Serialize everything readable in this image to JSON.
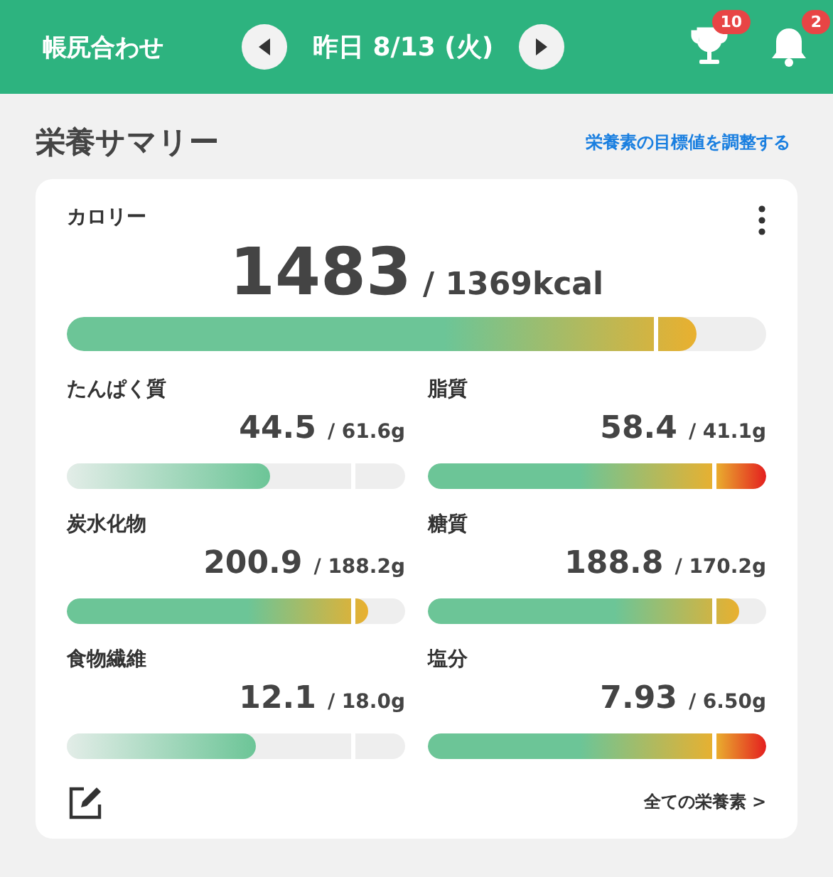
{
  "header": {
    "title": "帳尻合わせ",
    "date": "昨日 8/13 (火)",
    "trophy_badge": "10",
    "bell_badge": "2"
  },
  "section": {
    "title": "栄養サマリー",
    "link": "栄養素の目標値を調整する"
  },
  "calorie": {
    "label": "カロリー",
    "value": "1483",
    "target": "/ 1369kcal",
    "level": 0.9,
    "kind": "over"
  },
  "nutrients": [
    {
      "label": "たんぱく質",
      "value": "44.5",
      "target": "/ 61.6g",
      "level": 0.6,
      "kind": "under"
    },
    {
      "label": "脂質",
      "value": "58.4",
      "target": "/ 41.1g",
      "level": 1,
      "kind": "excess"
    },
    {
      "label": "炭水化物",
      "value": "200.9",
      "target": "/ 188.2g",
      "level": 0.89,
      "kind": "over"
    },
    {
      "label": "糖質",
      "value": "188.8",
      "target": "/ 170.2g",
      "level": 0.92,
      "kind": "over"
    },
    {
      "label": "食物繊維",
      "value": "12.1",
      "target": "/ 18.0g",
      "level": 0.56,
      "kind": "under"
    },
    {
      "label": "塩分",
      "value": "7.93",
      "target": "/ 6.50g",
      "level": 1,
      "kind": "excess"
    }
  ],
  "footer": {
    "link": "全ての栄養素 >"
  }
}
